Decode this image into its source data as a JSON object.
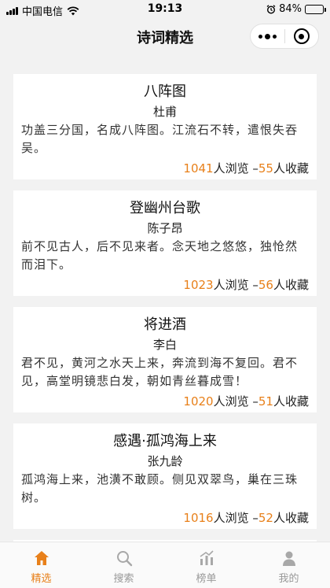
{
  "status_bar": {
    "carrier": "中国电信",
    "time": "19:13",
    "battery": "84%",
    "battery_level": 0.84
  },
  "nav": {
    "title": "诗词精选"
  },
  "poems": [
    {
      "title": "八阵图",
      "author": "杜甫",
      "excerpt": "功盖三分国，名成八阵图。江流石不转，遣恨失吞吴。",
      "views": "1041",
      "views_label": "人浏览",
      "separator": " –",
      "favorites": "55",
      "favorites_label": "人收藏"
    },
    {
      "title": "登幽州台歌",
      "author": "陈子昂",
      "excerpt": "前不见古人，后不见来者。念天地之悠悠，独怆然而泪下。",
      "views": "1023",
      "views_label": "人浏览",
      "separator": " –",
      "favorites": "56",
      "favorites_label": "人收藏"
    },
    {
      "title": "将进酒",
      "author": "李白",
      "excerpt": "君不见，黄河之水天上来，奔流到海不复回。君不见，高堂明镜悲白发，朝如青丝暮成雪！",
      "views": "1020",
      "views_label": "人浏览",
      "separator": " –",
      "favorites": "51",
      "favorites_label": "人收藏"
    },
    {
      "title": "感遇·孤鸿海上来",
      "author": "张九龄",
      "excerpt": "孤鸿海上来，池潢不敢顾。侧见双翠鸟，巢在三珠树。",
      "views": "1016",
      "views_label": "人浏览",
      "separator": " –",
      "favorites": "52",
      "favorites_label": "人收藏"
    }
  ],
  "tabs": [
    {
      "label": "精选",
      "icon": "home-icon",
      "active": true
    },
    {
      "label": "搜索",
      "icon": "search-icon",
      "active": false
    },
    {
      "label": "榜单",
      "icon": "chart-icon",
      "active": false
    },
    {
      "label": "我的",
      "icon": "user-icon",
      "active": false
    }
  ],
  "colors": {
    "accent": "#e8801a",
    "background": "#f2f2f2",
    "card": "#ffffff"
  }
}
